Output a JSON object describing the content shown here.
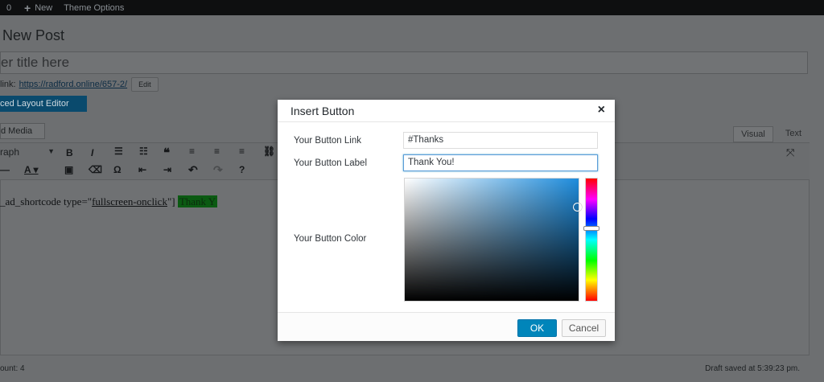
{
  "adminbar": {
    "comments_count": "0",
    "new_label": "New",
    "theme_options": "Theme Options"
  },
  "page": {
    "title": "New Post",
    "title_placeholder": "er title here",
    "permalink_label": "link:",
    "permalink_url": "https://radford.online/657-2/",
    "permalink_edit": "Edit",
    "layout_editor_button": "ced Layout Editor",
    "add_media_button": "d Media",
    "tab_visual": "Visual",
    "tab_text": "Text",
    "format_select": "raph",
    "content": {
      "prefix": "_ad_shortcode type=\"",
      "type_value": "fullscreen-onclick",
      "suffix": "\"]",
      "highlight": "Thank Y"
    },
    "word_count": "ount: 4",
    "draft_saved": "Draft saved at 5:39:23 pm."
  },
  "modal": {
    "title": "Insert Button",
    "close_icon": "×",
    "link_label": "Your Button Link",
    "link_value": "#Thanks",
    "label_label": "Your Button Label",
    "label_value": "Thank You!",
    "color_label": "Your Button Color",
    "ok_label": "OK",
    "cancel_label": "Cancel"
  },
  "colors": {
    "primary": "#0085ba",
    "picker_hue": "#1e8cdc"
  }
}
